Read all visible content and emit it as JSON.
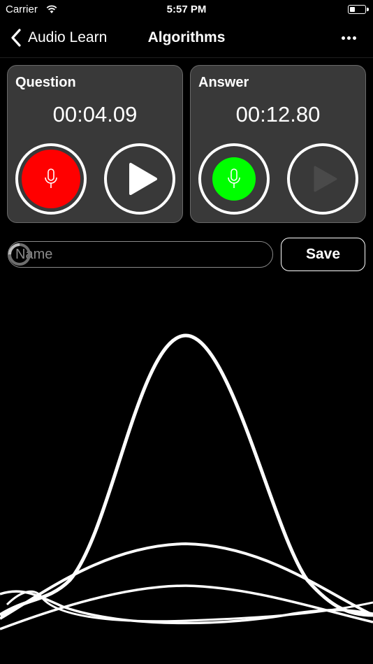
{
  "status_bar": {
    "carrier": "Carrier",
    "time": "5:57 PM"
  },
  "nav": {
    "back_label": "Audio Learn",
    "title": "Algorithms"
  },
  "question_card": {
    "title": "Question",
    "time": "00:04.09",
    "record_state": "active",
    "record_color": "#ff0000"
  },
  "answer_card": {
    "title": "Answer",
    "time": "00:12.80",
    "record_color": "#00ff00",
    "play_enabled": false
  },
  "name_field": {
    "placeholder": "Name",
    "value": ""
  },
  "save_button": {
    "label": "Save"
  },
  "colors": {
    "background": "#000000",
    "card": "#393939",
    "text": "#ffffff",
    "disabled_play": "#4a4a4a"
  }
}
